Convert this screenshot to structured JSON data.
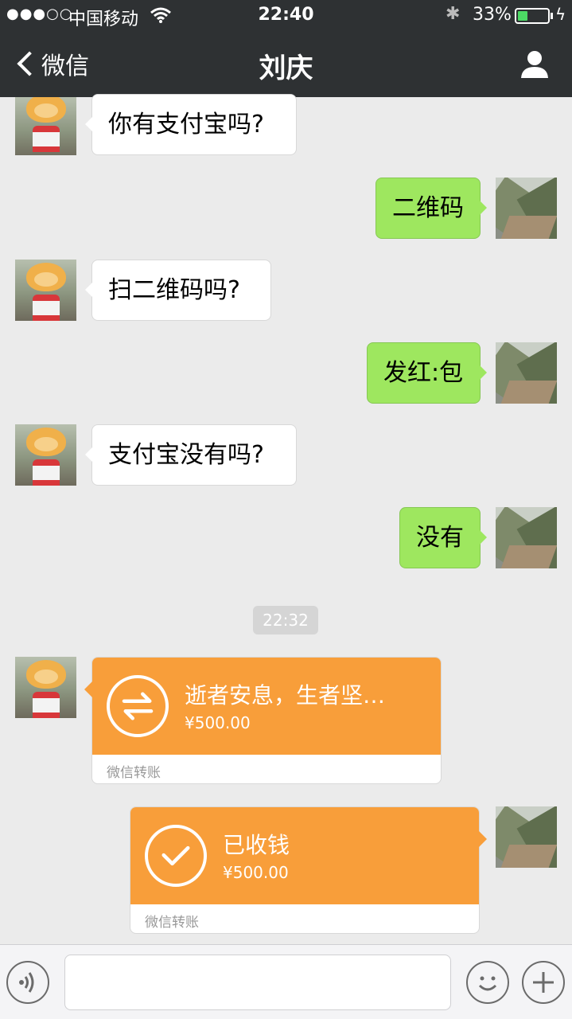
{
  "status_bar": {
    "signal": "●●●○○",
    "carrier": "中国移动",
    "time": "22:40",
    "battery_percent": "33%",
    "battery_level": 0.33,
    "wifi_icon": "wifi-icon",
    "bluetooth_icon": "bluetooth-icon",
    "charge_icon": "charging-bolt-icon"
  },
  "nav": {
    "back_label": "微信",
    "title": "刘庆",
    "profile_icon": "person-icon"
  },
  "messages": [
    {
      "side": "left",
      "text": "你有支付宝吗?"
    },
    {
      "side": "right",
      "text": "二维码"
    },
    {
      "side": "left",
      "text": "扫二维码吗?"
    },
    {
      "side": "right",
      "text": "发红:包"
    },
    {
      "side": "left",
      "text": "支付宝没有吗?"
    },
    {
      "side": "right",
      "text": "没有"
    }
  ],
  "timestamp": "22:32",
  "transfers": [
    {
      "side": "left",
      "title": "逝者安息，生者坚…",
      "amount": "¥500.00",
      "label": "微信转账",
      "icon": "transfer-arrows-icon"
    },
    {
      "side": "right",
      "title": "已收钱",
      "amount": "¥500.00",
      "label": "微信转账",
      "icon": "checkmark-icon"
    }
  ],
  "input_bar": {
    "voice_icon": "voice-icon",
    "emoji_icon": "emoji-icon",
    "plus_icon": "plus-icon",
    "input_value": ""
  },
  "colors": {
    "nav_bg": "#2e3133",
    "chat_bg": "#ebebeb",
    "bubble_right": "#9ee75f",
    "transfer_orange": "#f89e3a"
  }
}
